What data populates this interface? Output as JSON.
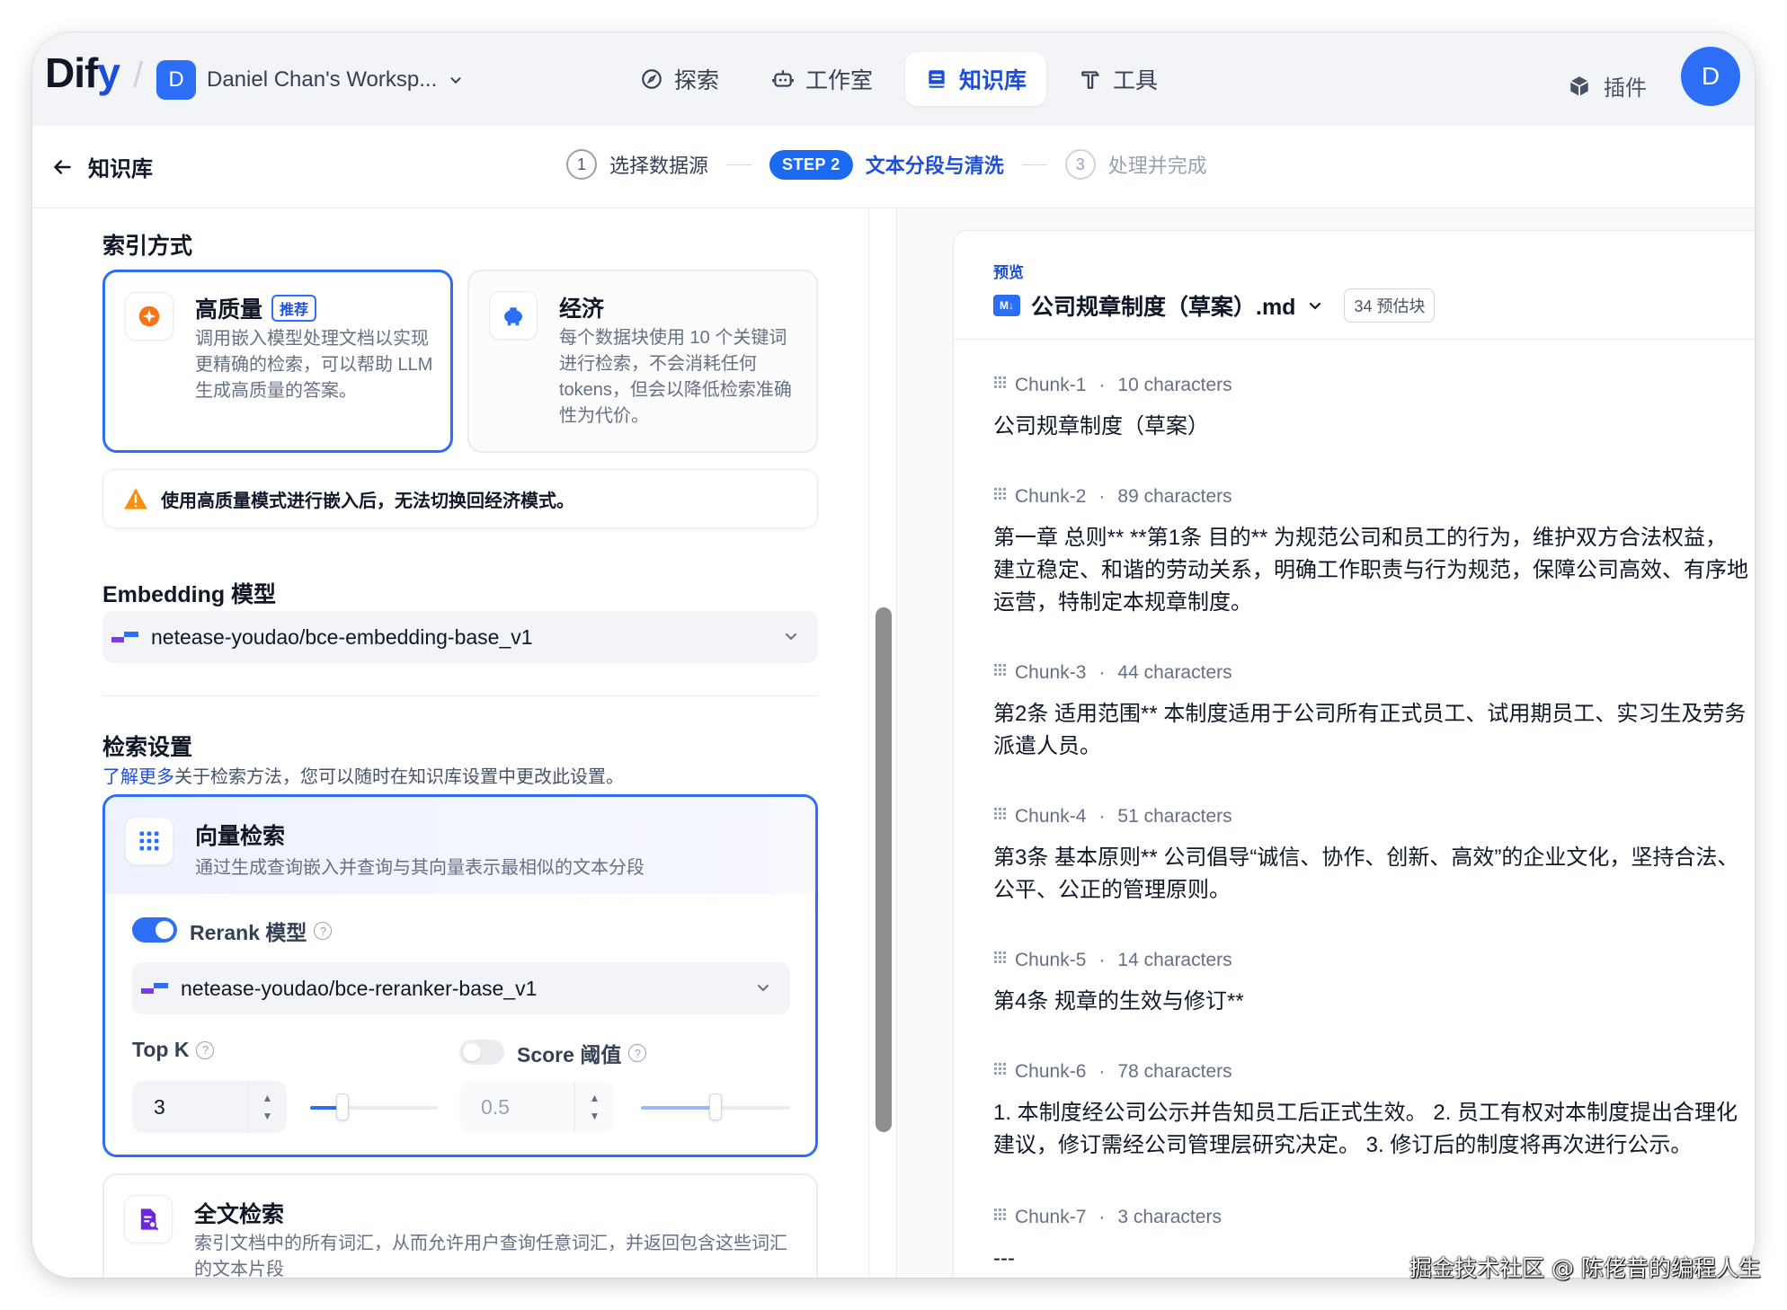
{
  "header": {
    "logo_text_a": "Di",
    "logo_text_b": "f",
    "logo_text_c": "y",
    "workspace_initial": "D",
    "workspace_name": "Daniel Chan's Worksp...",
    "nav": [
      {
        "label": "探索"
      },
      {
        "label": "工作室"
      },
      {
        "label": "知识库"
      },
      {
        "label": "工具"
      }
    ],
    "plugin_label": "插件",
    "user_initial": "D"
  },
  "stepbar": {
    "back_label": "知识库",
    "step1_num": "1",
    "step1_label": "选择数据源",
    "step2_pill": "STEP 2",
    "step2_label": "文本分段与清洗",
    "step3_num": "3",
    "step3_label": "处理并完成"
  },
  "left": {
    "index_title": "索引方式",
    "high_quality": {
      "title": "高质量",
      "badge": "推荐",
      "desc": "调用嵌入模型处理文档以实现更精确的检索，可以帮助 LLM 生成高质量的答案。"
    },
    "economy": {
      "title": "经济",
      "desc": "每个数据块使用 10 个关键词进行检索，不会消耗任何 tokens，但会以降低检索准确性为代价。"
    },
    "warning": "使用高质量模式进行嵌入后，无法切换回经济模式。",
    "embedding_title": "Embedding 模型",
    "embedding_model": "netease-youdao/bce-embedding-base_v1",
    "retrieval_title": "检索设置",
    "learn_more": "了解更多",
    "learn_rest": "关于检索方法，您可以随时在知识库设置中更改此设置。",
    "vector": {
      "title": "向量检索",
      "desc": "通过生成查询嵌入并查询与其向量表示最相似的文本分段",
      "rerank_label": "Rerank 模型",
      "rerank_model": "netease-youdao/bce-reranker-base_v1",
      "topk_label": "Top K",
      "topk_value": "3",
      "score_label": "Score 阈值",
      "score_value": "0.5",
      "topk_fraction": 0.25,
      "score_fraction": 0.5,
      "rerank_on": true,
      "score_on": false
    },
    "fulltext": {
      "title": "全文检索",
      "desc": "索引文档中的所有词汇，从而允许用户查询任意词汇，并返回包含这些词汇的文本片段"
    }
  },
  "preview": {
    "tag": "预览",
    "md_badge": "M↓",
    "file_name": "公司规章制度（草案）.md",
    "chunk_count": "34 预估块",
    "chunks": [
      {
        "name": "Chunk-1",
        "chars": "10 characters",
        "text": "公司规章制度（草案）"
      },
      {
        "name": "Chunk-2",
        "chars": "89 characters",
        "text": "第一章 总则** **第1条 目的** 为规范公司和员工的行为，维护双方合法权益，建立稳定、和谐的劳动关系，明确工作职责与行为规范，保障公司高效、有序地运营，特制定本规章制度。"
      },
      {
        "name": "Chunk-3",
        "chars": "44 characters",
        "text": "第2条 适用范围** 本制度适用于公司所有正式员工、试用期员工、实习生及劳务派遣人员。"
      },
      {
        "name": "Chunk-4",
        "chars": "51 characters",
        "text": "第3条 基本原则** 公司倡导“诚信、协作、创新、高效”的企业文化，坚持合法、公平、公正的管理原则。"
      },
      {
        "name": "Chunk-5",
        "chars": "14 characters",
        "text": "第4条 规章的生效与修订**"
      },
      {
        "name": "Chunk-6",
        "chars": "78 characters",
        "text": "1. 本制度经公司公示并告知员工后正式生效。 2. 员工有权对本制度提出合理化建议，修订需经公司管理层研究决定。 3. 修订后的制度将再次进行公示。"
      },
      {
        "name": "Chunk-7",
        "chars": "3 characters",
        "text": "---"
      }
    ]
  },
  "watermark": "掘金技术社区 @ 陈佬昔的编程人生"
}
